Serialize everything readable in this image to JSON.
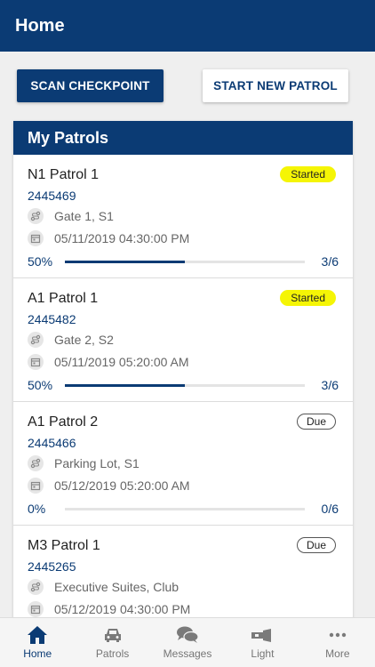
{
  "header": {
    "title": "Home"
  },
  "actions": {
    "scan_label": "SCAN CHECKPOINT",
    "new_label": "START NEW PATROL"
  },
  "panel": {
    "title": "My Patrols"
  },
  "patrols": [
    {
      "name": "N1 Patrol 1",
      "status": "Started",
      "id": "2445469",
      "location": "Gate 1, S1",
      "datetime": "05/11/2019 04:30:00 PM",
      "progress_text": "50%",
      "progress": 0.5,
      "count": "3/6"
    },
    {
      "name": "A1 Patrol 1",
      "status": "Started",
      "id": "2445482",
      "location": "Gate 2, S2",
      "datetime": "05/11/2019 05:20:00 AM",
      "progress_text": "50%",
      "progress": 0.5,
      "count": "3/6"
    },
    {
      "name": "A1 Patrol 2",
      "status": "Due",
      "id": "2445466",
      "location": "Parking Lot, S1",
      "datetime": "05/12/2019 05:20:00 AM",
      "progress_text": "0%",
      "progress": 0,
      "count": "0/6"
    },
    {
      "name": "M3 Patrol 1",
      "status": "Due",
      "id": "2445265",
      "location": "Executive Suites, Club",
      "datetime": "05/12/2019 04:30:00 PM",
      "progress_text": "0%",
      "progress": 0,
      "count": "0/6"
    }
  ],
  "nav": [
    {
      "label": "Home",
      "icon": "home-icon"
    },
    {
      "label": "Patrols",
      "icon": "car-icon"
    },
    {
      "label": "Messages",
      "icon": "chat-icon"
    },
    {
      "label": "Light",
      "icon": "flashlight-icon"
    },
    {
      "label": "More",
      "icon": "more-icon"
    }
  ],
  "colors": {
    "primary": "#0b3b74",
    "started_badge": "#f5f505"
  }
}
